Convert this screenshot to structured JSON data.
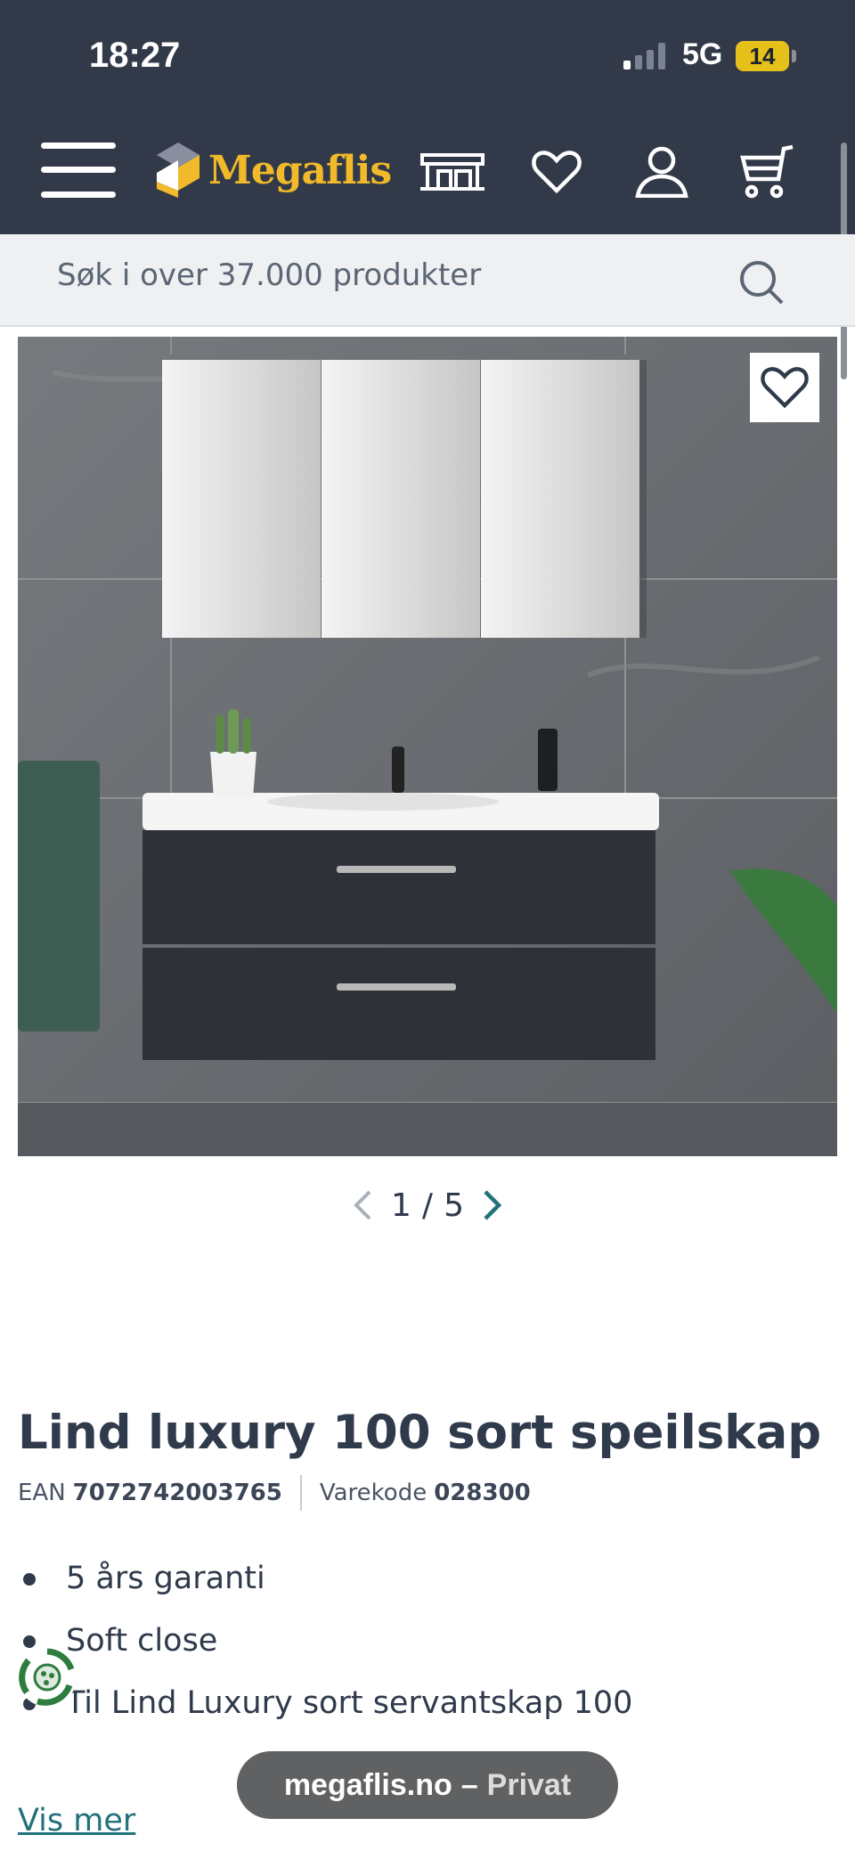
{
  "status_bar": {
    "time": "18:27",
    "network": "5G",
    "battery": "14"
  },
  "header": {
    "logo": "Megaflis"
  },
  "search": {
    "placeholder": "Søk i over 37.000 produkter"
  },
  "gallery": {
    "current": "1",
    "separator": "/",
    "total": "5"
  },
  "product": {
    "title": "Lind luxury 100 sort speilskap",
    "ean_label": "EAN",
    "ean": "7072742003765",
    "sku_label": "Varekode",
    "sku": "028300",
    "features": [
      "5 års garanti",
      "Soft close",
      "Til Lind Luxury sort servantskap 100"
    ],
    "more_link": "Vis mer"
  },
  "browser": {
    "domain": "megaflis.no",
    "dash": "–",
    "mode": "Privat"
  },
  "colors": {
    "header_bg": "#323a4a",
    "logo": "#f2b92a",
    "link": "#23717a",
    "text": "#2f3a4b"
  }
}
